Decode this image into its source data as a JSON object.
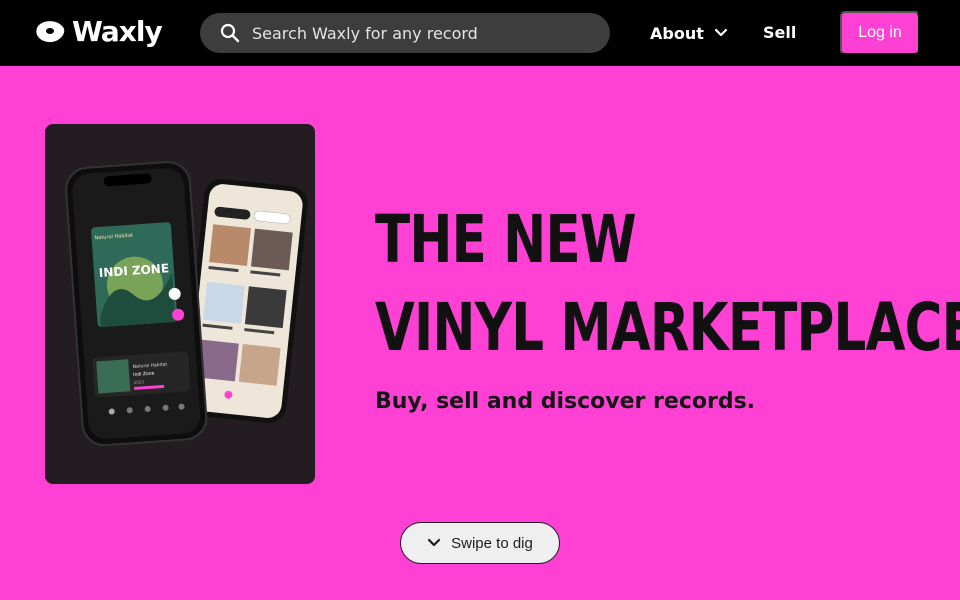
{
  "brand": {
    "name": "Waxly",
    "logo_icon": "vinyl-record-logo"
  },
  "search": {
    "placeholder": "Search Waxly for any record",
    "icon": "search-icon"
  },
  "nav": {
    "about_label": "About",
    "about_icon": "chevron-down-icon",
    "sell_label": "Sell",
    "login_label": "Log in"
  },
  "hero": {
    "headline_line1": "THE NEW",
    "headline_line2": "VINYL MARKETPLACE",
    "tagline": "Buy, sell and discover records.",
    "image": "app-phone-mockups"
  },
  "phone_screen": {
    "album_title": "INDI ZONE",
    "album_subtitle": "Natural Habitat",
    "now_playing_title": "Natural Habitat",
    "now_playing_artist": "Indi Zone",
    "now_playing_year": "2023"
  },
  "swipe": {
    "label": "Swipe to dig",
    "icon": "chevron-down-icon"
  },
  "colors": {
    "accent": "#ff40d4",
    "header_bg": "#000000",
    "card_bg": "#231c21"
  }
}
